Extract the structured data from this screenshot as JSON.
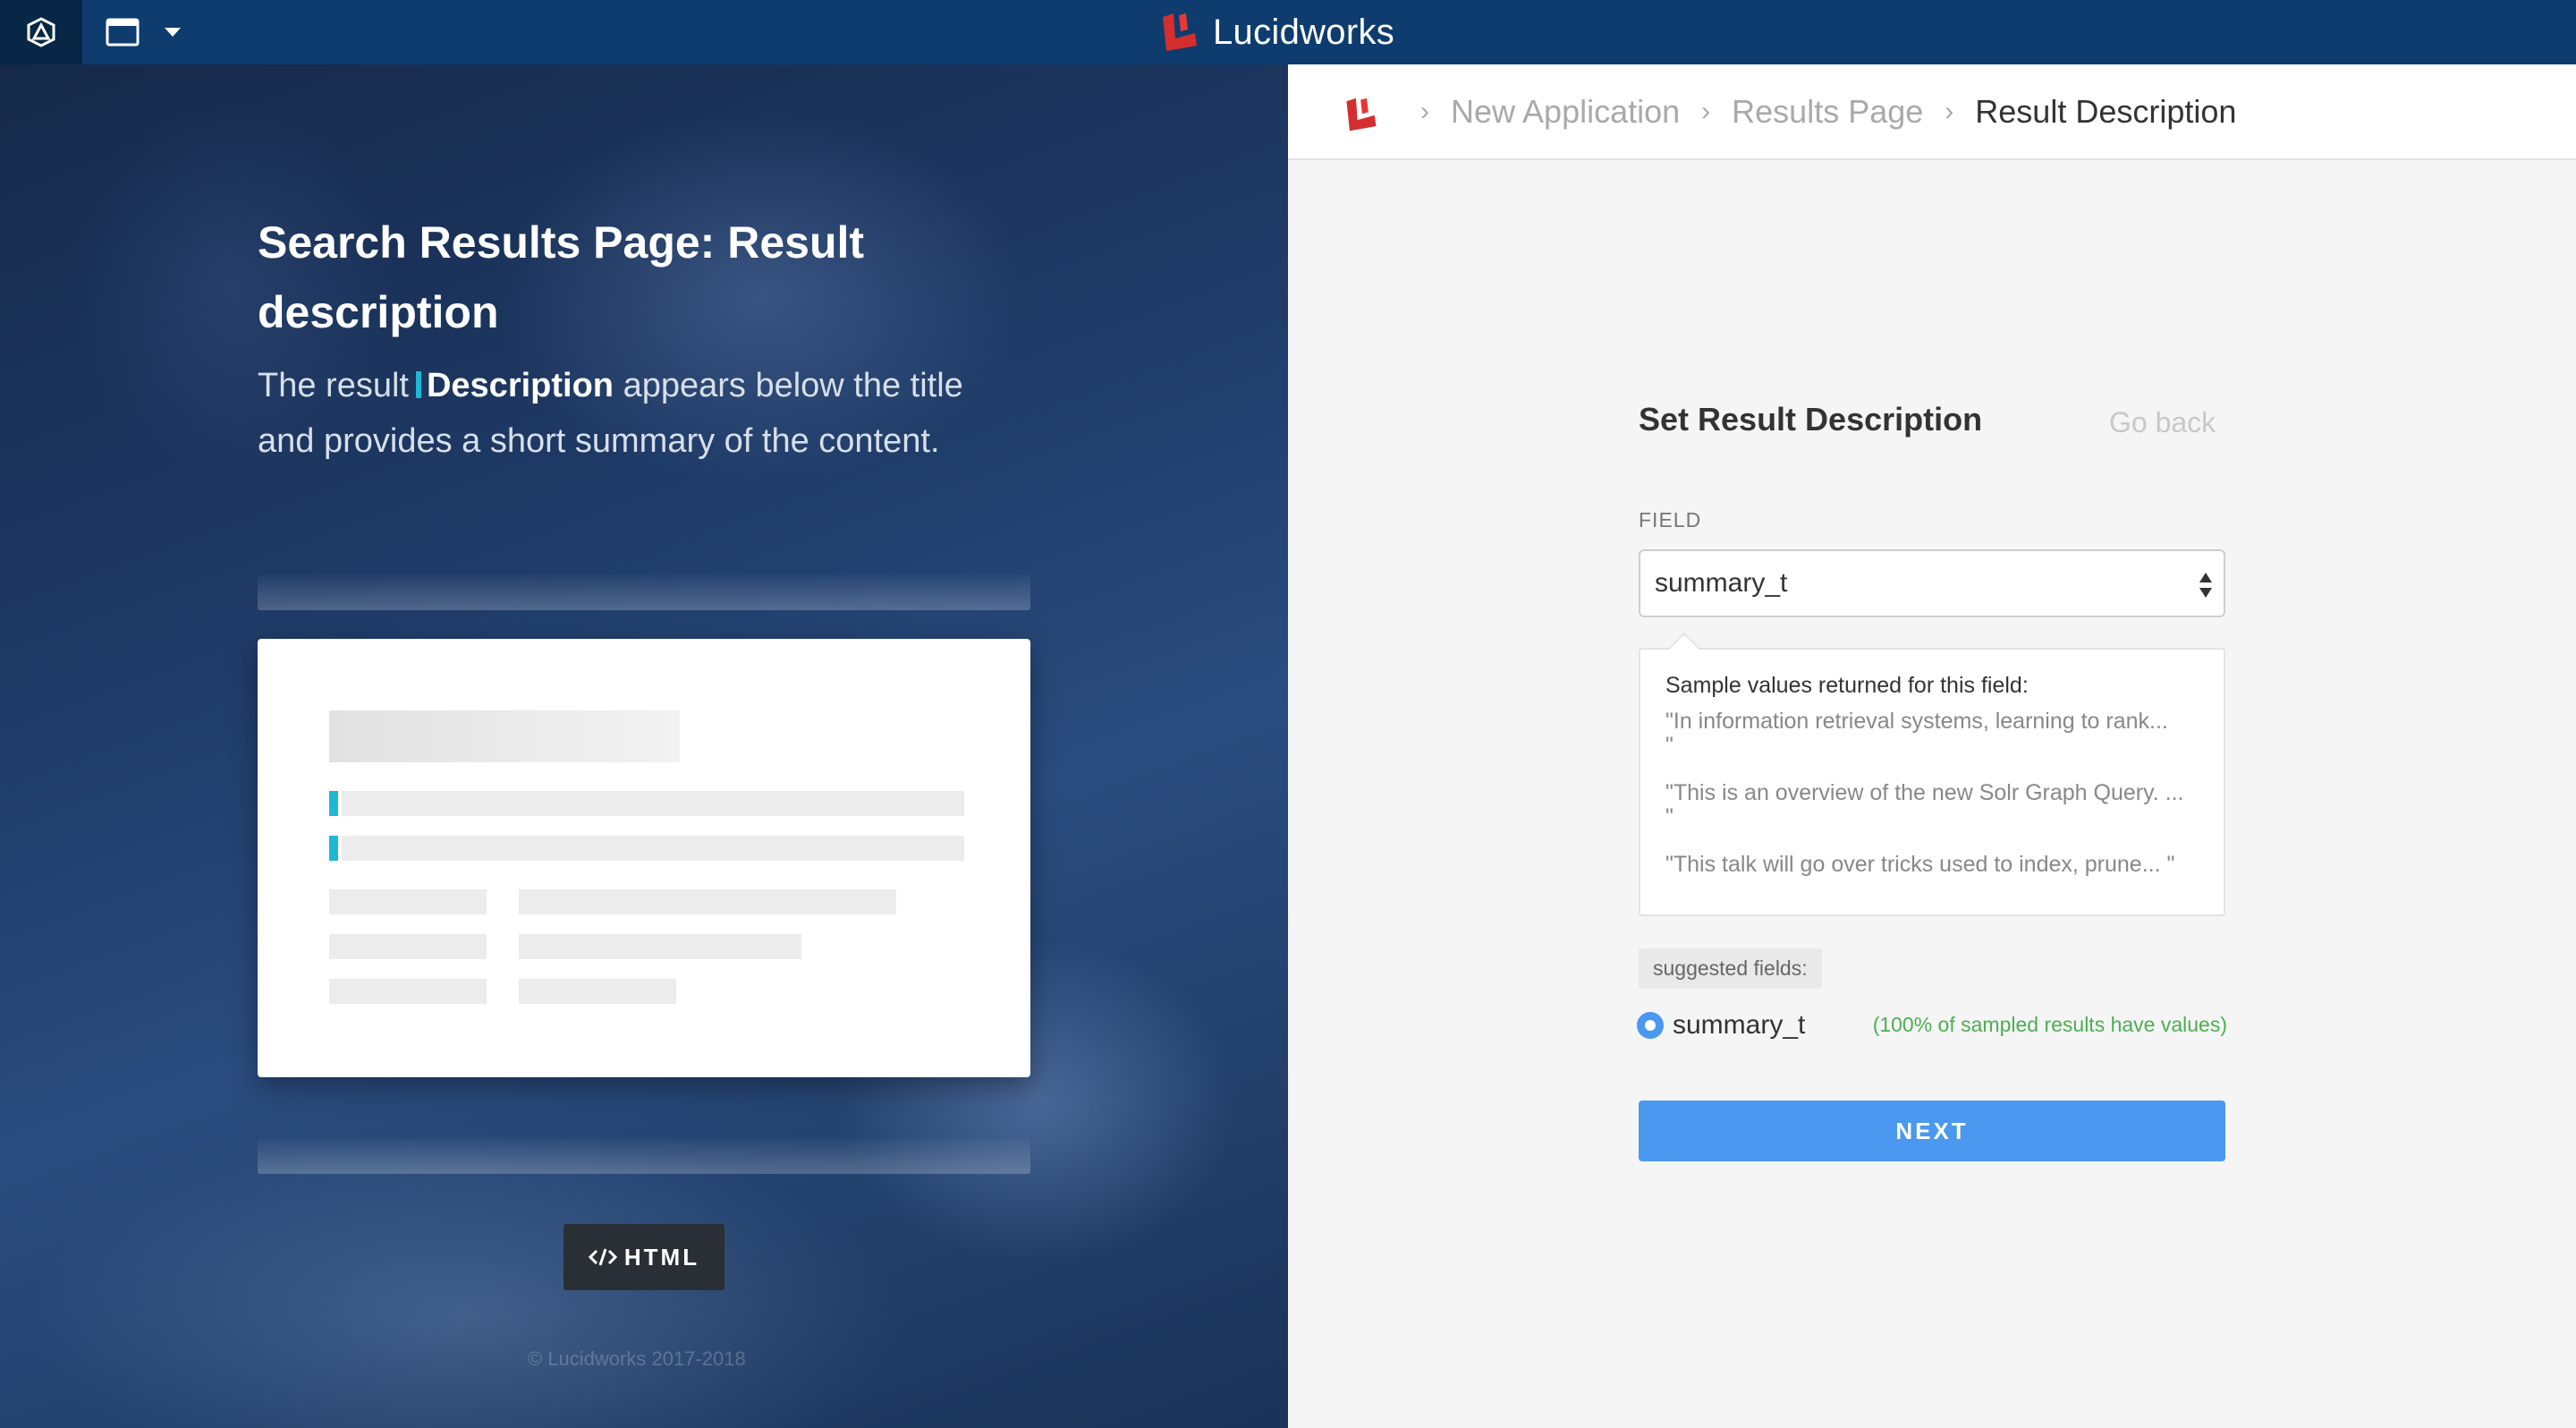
{
  "topbar": {
    "app_icon": "app-launcher-icon",
    "window_icon": "window-icon",
    "dropdown_icon": "caret-down-icon",
    "brand_name": "Lucidworks",
    "brand_color": "#d32f2f",
    "bar_color": "#0e3c6e"
  },
  "hero": {
    "title": "Search Results Page: Result description",
    "desc_prefix": "The result",
    "desc_highlight": "Description",
    "desc_suffix": "appears below the title and provides a short summary of the content.",
    "accent_color": "#1fb7d4",
    "html_button_icon": "code-icon",
    "html_button_label": "HTML",
    "copyright": "© Lucidworks 2017-2018"
  },
  "breadcrumb": {
    "items": [
      "New Application",
      "Results Page",
      "Result Description"
    ],
    "separator_icon": "chevron-right-icon"
  },
  "form": {
    "title": "Set Result Description",
    "go_back": "Go back",
    "field_label": "FIELD",
    "field_value": "summary_t",
    "samples_title": "Sample values returned for this field:",
    "samples": [
      "\"In information retrieval systems, learning to rank...\n\"",
      "\"This is an overview of the new Solr Graph Query. ...\n\"",
      "\"This talk will go over tricks used to index, prune... \""
    ],
    "suggested_label": "suggested fields:",
    "suggested_field": "summary_t",
    "suggested_note": "(100% of sampled results have values)",
    "next_label": "NEXT",
    "primary_color": "#4a98f0",
    "note_color": "#4caf50"
  }
}
